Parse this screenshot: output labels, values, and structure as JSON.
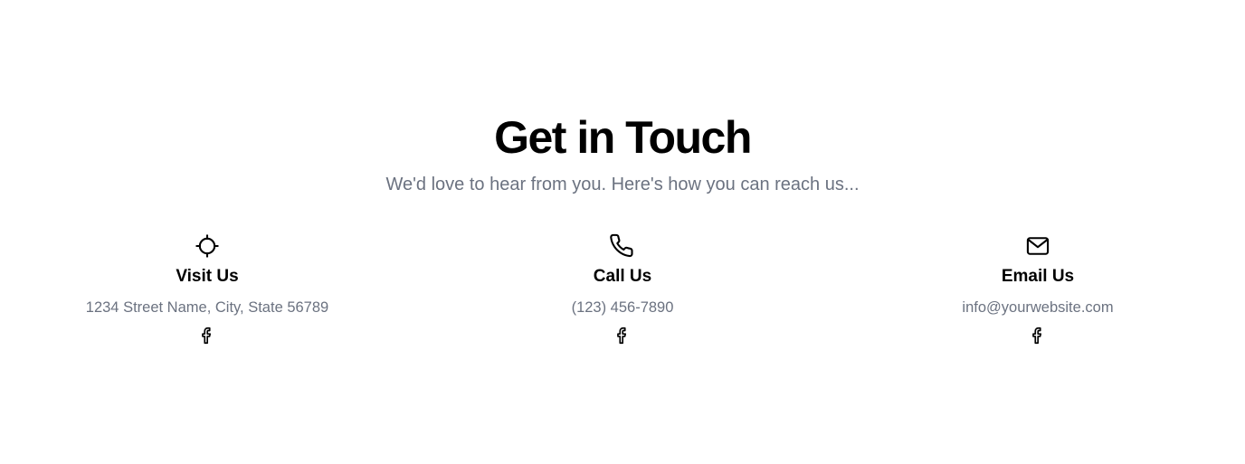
{
  "contact": {
    "title": "Get in Touch",
    "subtitle": "We'd love to hear from you. Here's how you can reach us...",
    "items": [
      {
        "icon": "location-crosshair-icon",
        "title": "Visit Us",
        "text": "1234 Street Name, City, State 56789",
        "social_icon": "facebook-icon"
      },
      {
        "icon": "phone-icon",
        "title": "Call Us",
        "text": "(123) 456-7890",
        "social_icon": "facebook-icon"
      },
      {
        "icon": "mail-icon",
        "title": "Email Us",
        "text": "info@yourwebsite.com",
        "social_icon": "facebook-icon"
      }
    ]
  },
  "colors": {
    "heading": "#000000",
    "muted": "#6b7280",
    "background": "#ffffff"
  }
}
